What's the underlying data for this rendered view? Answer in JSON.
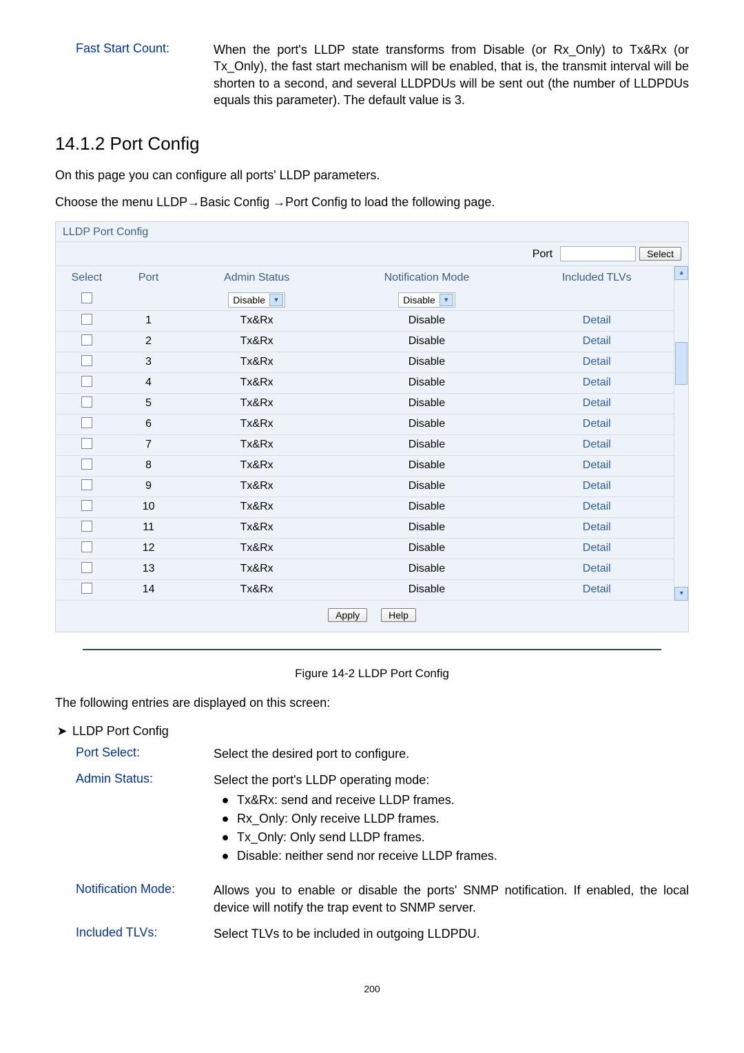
{
  "fast_start": {
    "label": "Fast Start Count:",
    "text": "When the port's LLDP state transforms from Disable (or Rx_Only) to Tx&Rx (or Tx_Only), the fast start mechanism will be enabled, that is, the transmit interval will be shorten to a second, and several LLDPDUs will be sent out (the number of LLDPDUs equals this parameter). The default value is 3."
  },
  "section_heading": "14.1.2  Port Config",
  "intro_para": "On this page you can configure all ports' LLDP parameters.",
  "menu_para": "Choose the menu LLDP→Basic Config  →Port Config   to load the following page.",
  "panel": {
    "title": "LLDP Port Config",
    "filter_label": "Port",
    "select_btn": "Select",
    "headers": {
      "select": "Select",
      "port": "Port",
      "admin": "Admin Status",
      "notif": "Notification Mode",
      "tlvs": "Included TLVs"
    },
    "admin_default": "Disable",
    "notif_default": "Disable",
    "detail_label": "Detail",
    "rows": [
      {
        "port": "1",
        "admin": "Tx&Rx",
        "notif": "Disable"
      },
      {
        "port": "2",
        "admin": "Tx&Rx",
        "notif": "Disable"
      },
      {
        "port": "3",
        "admin": "Tx&Rx",
        "notif": "Disable"
      },
      {
        "port": "4",
        "admin": "Tx&Rx",
        "notif": "Disable"
      },
      {
        "port": "5",
        "admin": "Tx&Rx",
        "notif": "Disable"
      },
      {
        "port": "6",
        "admin": "Tx&Rx",
        "notif": "Disable"
      },
      {
        "port": "7",
        "admin": "Tx&Rx",
        "notif": "Disable"
      },
      {
        "port": "8",
        "admin": "Tx&Rx",
        "notif": "Disable"
      },
      {
        "port": "9",
        "admin": "Tx&Rx",
        "notif": "Disable"
      },
      {
        "port": "10",
        "admin": "Tx&Rx",
        "notif": "Disable"
      },
      {
        "port": "11",
        "admin": "Tx&Rx",
        "notif": "Disable"
      },
      {
        "port": "12",
        "admin": "Tx&Rx",
        "notif": "Disable"
      },
      {
        "port": "13",
        "admin": "Tx&Rx",
        "notif": "Disable"
      },
      {
        "port": "14",
        "admin": "Tx&Rx",
        "notif": "Disable"
      }
    ],
    "apply_btn": "Apply",
    "help_btn": "Help"
  },
  "fig_caption": "Figure 14-2 LLDP Port Config",
  "entries_intro": "The following entries are displayed on this screen:",
  "sub_heading": "LLDP  Port Config",
  "defs": {
    "port_select": {
      "label": "Port Select:",
      "text": "Select the desired port to configure."
    },
    "admin_status": {
      "label": "Admin Status:",
      "intro": "Select the port's LLDP operating mode:",
      "bullets": [
        "Tx&Rx: send and receive LLDP frames.",
        "Rx_Only: Only receive LLDP frames.",
        "Tx_Only: Only send LLDP frames.",
        "Disable: neither send nor receive LLDP frames."
      ]
    },
    "notification": {
      "label": "Notification Mode:",
      "text": "Allows you to enable or disable the ports' SNMP notification. If enabled, the local device will notify the trap event to SNMP server."
    },
    "tlvs": {
      "label": "Included TLVs:",
      "text": "Select TLVs to be included in outgoing LLDPDU."
    }
  },
  "page_number": "200"
}
